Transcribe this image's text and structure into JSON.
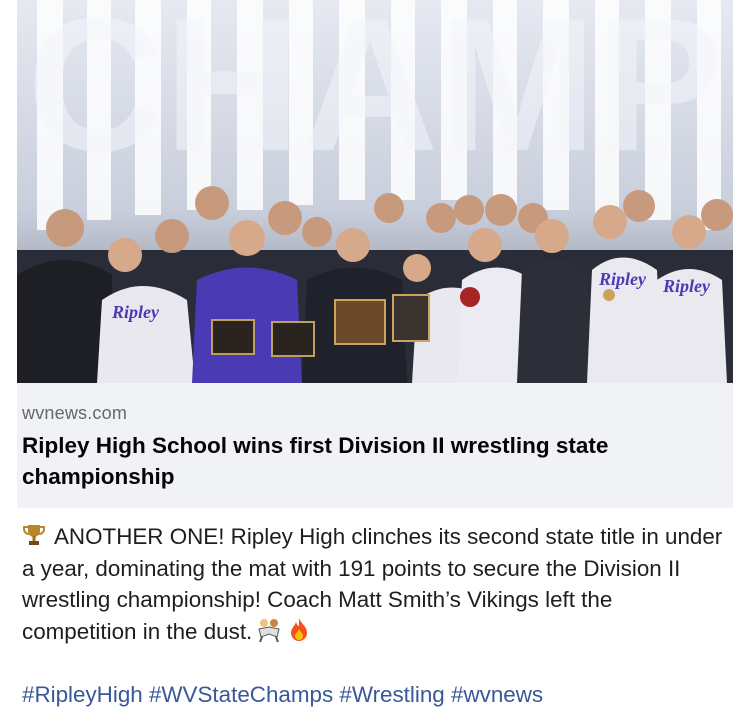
{
  "link_preview": {
    "domain": "wvnews.com",
    "title": "Ripley High School wins first Division II wrestling state championship"
  },
  "photo": {
    "banner_text": "CHAMP",
    "jersey_text": "Ripley"
  },
  "post": {
    "text": "ANOTHER ONE! Ripley High clinches its second state title in under a year, dominating the mat with 191 points to secure the Division II wrestling championship! Coach Matt Smith’s Vikings left the competition in the dust.",
    "emoji_icons": [
      "trophy-icon",
      "wrestlers-icon",
      "fire-icon"
    ],
    "hashtags": [
      "#RipleyHigh",
      "#WVStateChamps",
      "#Wrestling",
      "#wvnews"
    ]
  },
  "colors": {
    "card_background": "#f0f2f5",
    "hashtag": "#385898",
    "domain_text": "#65676b",
    "jersey_purple": "#4a3bb5"
  }
}
